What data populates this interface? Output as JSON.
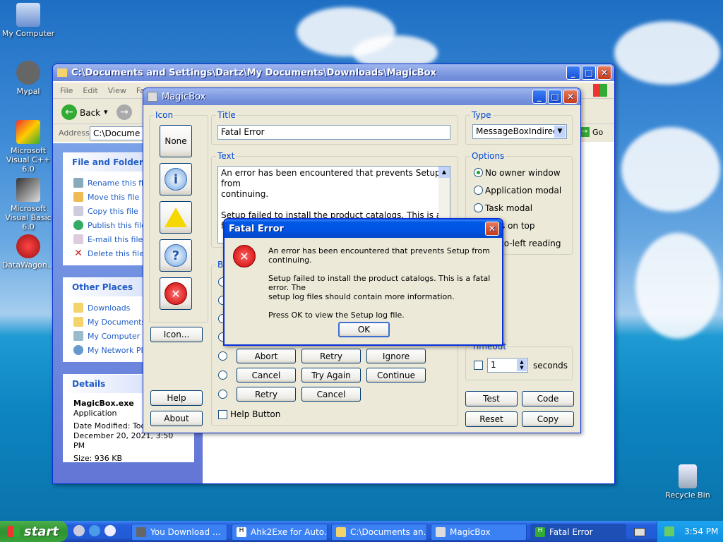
{
  "desktop": {
    "icons": [
      {
        "label": "My Computer"
      },
      {
        "label": "Mypal"
      },
      {
        "label": "Microsoft Visual C++ 6.0"
      },
      {
        "label": "Microsoft Visual Basic 6.0"
      },
      {
        "label": "DataWagon..."
      },
      {
        "label": "Recycle Bin"
      }
    ]
  },
  "explorer": {
    "title": "C:\\Documents and Settings\\Dartz\\My Documents\\Downloads\\MagicBox",
    "menu": [
      "File",
      "Edit",
      "View",
      "Fa"
    ],
    "back_label": "Back",
    "address_label": "Address",
    "address_value": "C:\\Docume",
    "go_label": "Go",
    "file_tasks_title": "File and Folder Ta",
    "file_tasks": [
      "Rename this file",
      "Move this file",
      "Copy this file",
      "Publish this file",
      "E-mail this file",
      "Delete this file"
    ],
    "other_places_title": "Other Places",
    "other_places": [
      "Downloads",
      "My Documents",
      "My Computer",
      "My Network Pla"
    ],
    "details_title": "Details",
    "details_name": "MagicBox.exe",
    "details_type": "Application",
    "details_modified": "Date Modified: Toda",
    "details_date": "December 20, 2021, 3:50 PM",
    "details_size": "Size: 936 KB"
  },
  "magicbox": {
    "title": "MagicBox",
    "icon_group": "Icon",
    "none_label": "None",
    "icon_button": "Icon...",
    "help_button": "Help",
    "about_button": "About",
    "title_group": "Title",
    "title_value": "Fatal Error",
    "text_group": "Text",
    "text_line1": "An error has been encountered that prevents Setup",
    "text_line2": "from",
    "text_line3": "continuing.",
    "text_line4": "Setup failed to install the product catalogs. This is a fatal",
    "buttons_group": "Bu",
    "button_rows": [
      [
        "Abort",
        "Retry",
        "Ignore"
      ],
      [
        "Cancel",
        "Try Again",
        "Continue"
      ],
      [
        "Retry",
        "Cancel"
      ]
    ],
    "help_check": "Help Button",
    "type_group": "Type",
    "type_value": "MessageBoxIndirect",
    "options_group": "Options",
    "options": [
      "No owner window",
      "Application modal",
      "Task modal",
      "s on top",
      "to-left reading"
    ],
    "timeout_group": "Timeout",
    "timeout_value": "1",
    "timeout_unit": "seconds",
    "test_button": "Test",
    "code_button": "Code",
    "reset_button": "Reset",
    "copy_button": "Copy"
  },
  "dialog": {
    "title": "Fatal Error",
    "line1": "An error has been encountered that prevents Setup from",
    "line2": "continuing.",
    "line3": "Setup failed to install the product catalogs. This is a fatal error. The",
    "line4": "setup log files should contain more information.",
    "line5": "Press OK to view the Setup log file.",
    "ok_label": "OK"
  },
  "taskbar": {
    "start_label": "start",
    "tasks": [
      "You Download ...",
      "Ahk2Exe for Auto...",
      "C:\\Documents an...",
      "MagicBox",
      "Fatal Error"
    ],
    "clock": "3:54 PM"
  }
}
